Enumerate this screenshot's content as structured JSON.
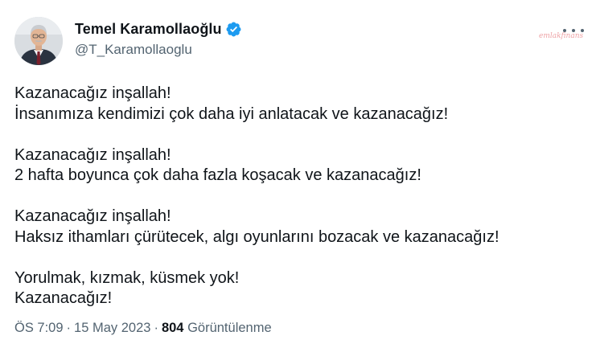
{
  "author": {
    "name": "Temel Karamollaoğlu",
    "handle": "@T_Karamollaoglu",
    "verified": true
  },
  "watermark": "emlakfinans",
  "colors": {
    "text": "#0f1419",
    "secondary": "#536471",
    "verified_badge": "#1d9bf0"
  },
  "icons": {
    "verified": "verified-badge-icon",
    "more": "more-options-icon",
    "avatar": "profile-photo"
  },
  "tweet": {
    "lines": [
      "Kazanacağız inşallah!",
      "İnsanımıza kendimizi çok daha iyi anlatacak ve kazanacağız!",
      "",
      "Kazanacağız inşallah!",
      "2 hafta boyunca çok daha fazla koşacak ve kazanacağız!",
      "",
      "Kazanacağız inşallah!",
      "Haksız ithamları çürütecek, algı oyunlarını bozacak ve kazanacağız!",
      "",
      "Yorulmak, kızmak, küsmek yok!",
      "Kazanacağız!"
    ]
  },
  "meta": {
    "time": "ÖS 7:09",
    "separator": "·",
    "date": "15 May 2023",
    "views_count": "804",
    "views_label": "Görüntülenme"
  }
}
